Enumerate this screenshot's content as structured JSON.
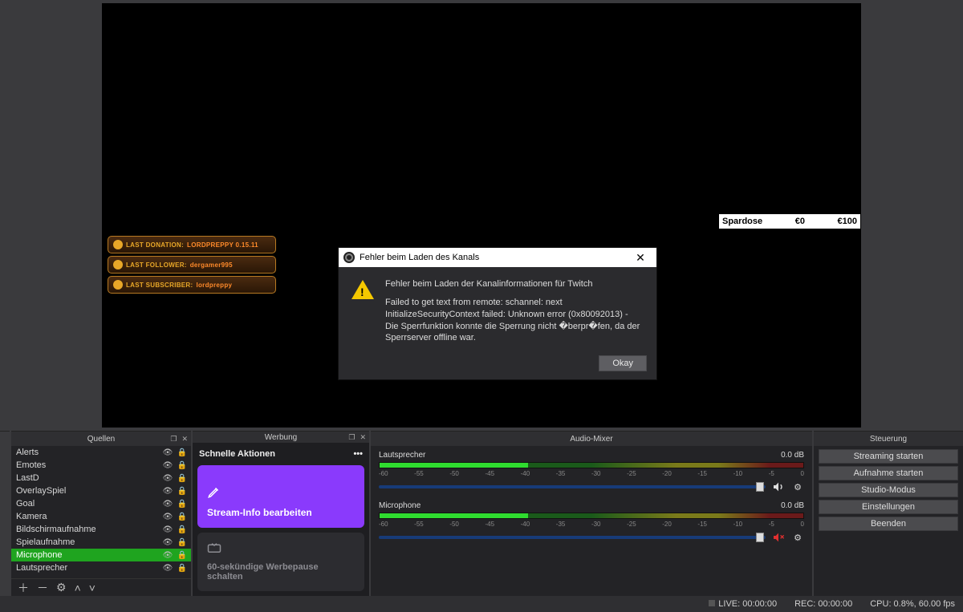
{
  "preview": {
    "banners": [
      {
        "label": "LAST DONATION:",
        "value": "LORDPREPPY 0.15.11"
      },
      {
        "label": "LAST FOLLOWER:",
        "value": "dergamer995"
      },
      {
        "label": "LAST SUBSCRIBER:",
        "value": "lordpreppy"
      }
    ],
    "spardose": {
      "label": "Spardose",
      "current": "€0",
      "goal": "€100"
    }
  },
  "dialog": {
    "title": "Fehler beim Laden des Kanals",
    "line1": "Fehler beim Laden der Kanalinformationen für Twitch",
    "line2": "Failed to get text from remote: schannel: next InitializeSecurityContext failed: Unknown error (0x80092013) - Die Sperrfunktion konnte die Sperrung nicht �berpr�fen, da der Sperrserver offline war.",
    "ok": "Okay"
  },
  "quellen": {
    "title": "Quellen",
    "items": [
      {
        "name": "Alerts",
        "selected": false
      },
      {
        "name": "Emotes",
        "selected": false
      },
      {
        "name": "LastD",
        "selected": false
      },
      {
        "name": "OverlaySpiel",
        "selected": false
      },
      {
        "name": "Goal",
        "selected": false
      },
      {
        "name": "Kamera",
        "selected": false
      },
      {
        "name": "Bildschirmaufnahme",
        "selected": false
      },
      {
        "name": "Spielaufnahme",
        "selected": false
      },
      {
        "name": "Microphone",
        "selected": true
      },
      {
        "name": "Lautsprecher",
        "selected": false
      }
    ]
  },
  "werbung": {
    "title": "Werbung",
    "quick": "Schnelle Aktionen",
    "card1": "Stream-Info bearbeiten",
    "card2": "60-sekündige Werbepause schalten"
  },
  "mixer": {
    "title": "Audio-Mixer",
    "ticks": [
      "-60",
      "-55",
      "-50",
      "-45",
      "-40",
      "-35",
      "-30",
      "-25",
      "-20",
      "-15",
      "-10",
      "-5",
      "0"
    ],
    "ch": [
      {
        "name": "Lautsprecher",
        "db": "0.0 dB",
        "muted": false
      },
      {
        "name": "Microphone",
        "db": "0.0 dB",
        "muted": true
      }
    ]
  },
  "steuerung": {
    "title": "Steuerung",
    "buttons": [
      "Streaming starten",
      "Aufnahme starten",
      "Studio-Modus",
      "Einstellungen",
      "Beenden"
    ]
  },
  "status": {
    "live": "LIVE: 00:00:00",
    "rec": "REC: 00:00:00",
    "cpu": "CPU: 0.8%, 60.00 fps"
  }
}
